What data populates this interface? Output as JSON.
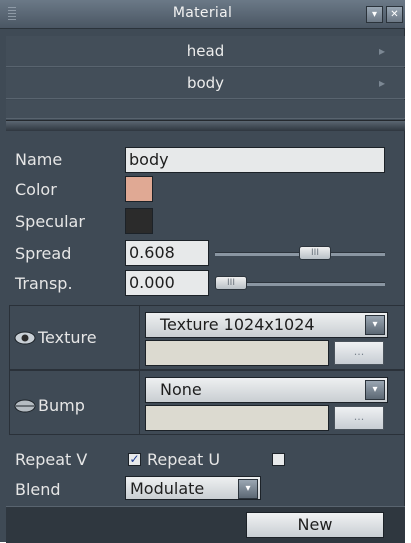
{
  "window": {
    "title": "Material",
    "min_glyph": "▾",
    "close_glyph": "✕"
  },
  "materials": [
    {
      "label": "head"
    },
    {
      "label": "body"
    }
  ],
  "properties": {
    "name_label": "Name",
    "name_value": "body",
    "color_label": "Color",
    "color_value": "#e0a994",
    "specular_label": "Specular",
    "specular_value": "#2b2b2b",
    "spread_label": "Spread",
    "spread_value": "0.608",
    "spread_level": 0.608,
    "transp_label": "Transp.",
    "transp_value": "0.000",
    "transp_level": 0.0
  },
  "maps": {
    "texture": {
      "label": "Texture",
      "selected": "Texture 1024x1024",
      "browse_label": "..."
    },
    "bump": {
      "label": "Bump",
      "selected": "None",
      "browse_label": "..."
    }
  },
  "options": {
    "repeat_v_label": "Repeat V",
    "repeat_v_checked": true,
    "repeat_u_label": "Repeat U",
    "repeat_u_checked": false,
    "blend_label": "Blend",
    "blend_value": "Modulate"
  },
  "footer": {
    "new_label": "New"
  },
  "icons": {
    "slider_grip": "III",
    "dropdown_arrow": "▾",
    "list_arrow": "▸"
  }
}
